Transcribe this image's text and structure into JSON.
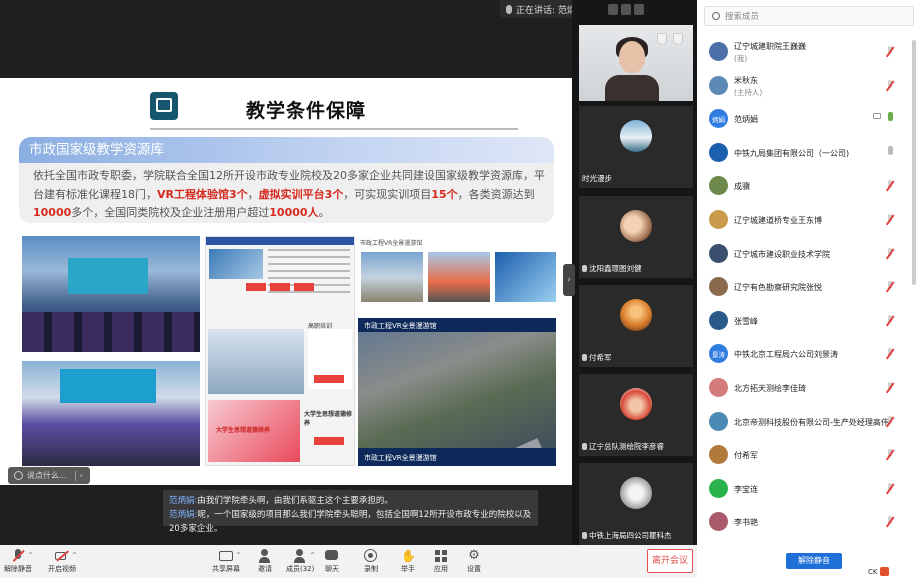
{
  "speaking": {
    "label": "正在讲话: 范炳娟;"
  },
  "slide": {
    "title": "教学条件保障",
    "box_title": "市政国家级教学资源库",
    "text_parts": [
      {
        "t": "依托全国市政专职委，学院联合全国12所开设市政专业院校及20多家企业共同建设国家级教学资源库，平台建有标准化课程18门，",
        "red": false
      },
      {
        "t": "VR工程体验馆3个",
        "red": true
      },
      {
        "t": "，",
        "red": false
      },
      {
        "t": "虚拟实训平台3个",
        "red": true
      },
      {
        "t": "，可实现实训项目",
        "red": false
      },
      {
        "t": "15个",
        "red": true
      },
      {
        "t": "，各类资源达到",
        "red": false
      },
      {
        "t": "10000",
        "red": true
      },
      {
        "t": "多个，全国同类院校及企业注册用户超过",
        "red": false
      },
      {
        "t": "10000人",
        "red": true
      },
      {
        "t": "。",
        "red": false
      }
    ],
    "p3_captions": {
      "c1": "高职培训",
      "c2": "大学生思想道德修养",
      "c3": "大学生思想道德修养"
    },
    "p4_caption": "市政工程VR全景漫游馆",
    "p4_vr": "市政工程VR全景漫游馆"
  },
  "say_pill": {
    "text": "说点什么..."
  },
  "chat": [
    {
      "name": "范炳娟:",
      "text": "由我们学院牵头啊，由我们系驱主这个主要承担的。"
    },
    {
      "name": "范炳娟:",
      "text": "呢，一个国家级的项目那么我们学院牵头聪明，包括全国啊12所开设市政专业的院校以及20多家企业。"
    }
  ],
  "gallery": [
    {
      "name": "时光漫步"
    },
    {
      "name": "沈阳鑫璟图刘健"
    },
    {
      "name": "付希军"
    },
    {
      "name": "辽宁总队测绘院李彦睿"
    },
    {
      "name": "中铁上海局四公司瞿科杰"
    }
  ],
  "search": {
    "placeholder": "搜索成员"
  },
  "participants": [
    {
      "name": "辽宁城建职院王巍巍",
      "note": "(我)",
      "av": "",
      "color": "#4c6fa8",
      "mic": "off",
      "cam": false
    },
    {
      "name": "米秋东",
      "note": "(主持人)",
      "av": "",
      "color": "#5d8ab5",
      "mic": "off",
      "cam": false
    },
    {
      "name": "范炳娟",
      "note": "",
      "av": "炳娟",
      "color": "#2f7de1",
      "mic": "on",
      "cam": true
    },
    {
      "name": "中铁九局集团有限公司（一公司)",
      "note": "",
      "av": "",
      "color": "#1b5fae",
      "mic": "gray",
      "cam": false
    },
    {
      "name": "成骥",
      "note": "",
      "av": "",
      "color": "#6d8a4c",
      "mic": "off",
      "cam": false
    },
    {
      "name": "辽宁城建道桥专业王东博",
      "note": "",
      "av": "",
      "color": "#c99a4a",
      "mic": "off",
      "cam": false
    },
    {
      "name": "辽宁城市建设职业技术学院",
      "note": "",
      "av": "",
      "color": "#3b4f6e",
      "mic": "off",
      "cam": false
    },
    {
      "name": "辽宁有色勘察研究院张悦",
      "note": "",
      "av": "",
      "color": "#8a6a4c",
      "mic": "off",
      "cam": false
    },
    {
      "name": "张雪峰",
      "note": "",
      "av": "",
      "color": "#2a5a8a",
      "mic": "off",
      "cam": false
    },
    {
      "name": "中铁北京工程局六公司刘景涛",
      "note": "",
      "av": "景涛",
      "color": "#2f7de1",
      "mic": "off",
      "cam": false
    },
    {
      "name": "北方拓天测绘李佳琦",
      "note": "",
      "av": "",
      "color": "#d47b7b",
      "mic": "off",
      "cam": false
    },
    {
      "name": "北京帝测科技股份有限公司-生产处经理高伟",
      "note": "",
      "av": "",
      "color": "#4a8ab5",
      "mic": "off",
      "cam": false
    },
    {
      "name": "付希军",
      "note": "",
      "av": "",
      "color": "#b07a3a",
      "mic": "off",
      "cam": false
    },
    {
      "name": "李宝连",
      "note": "",
      "av": "",
      "color": "#2ab34a",
      "mic": "off",
      "cam": false
    },
    {
      "name": "李书艳",
      "note": "",
      "av": "",
      "color": "#a85a6a",
      "mic": "off",
      "cam": false
    }
  ],
  "unmute_all": "解除静音",
  "tray": {
    "text": "CK"
  },
  "toolbar": {
    "mute": "解除静音",
    "video": "开启视频",
    "share": "共享屏幕",
    "invite": "邀请",
    "members": "成员(32)",
    "chat": "聊天",
    "record": "录制",
    "hand": "举手",
    "apps": "应用",
    "settings": "设置",
    "leave": "离开会议"
  }
}
